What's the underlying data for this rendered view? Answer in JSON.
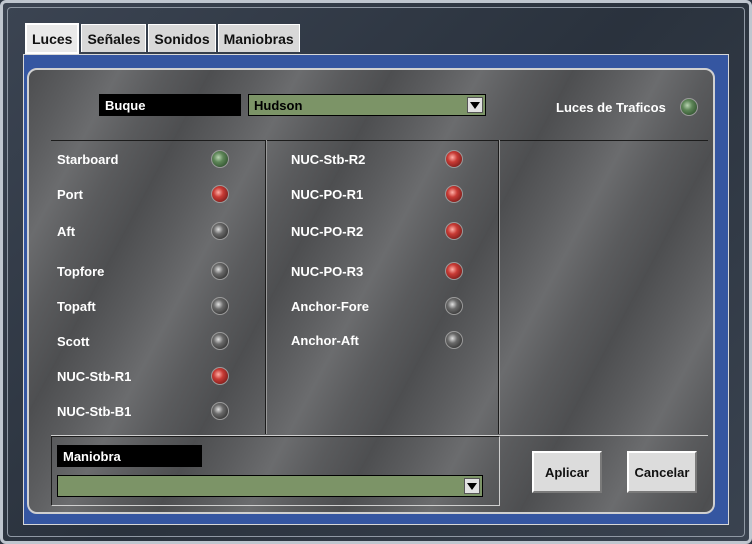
{
  "tabs": [
    {
      "label": "Luces",
      "active": true
    },
    {
      "label": "Señales",
      "active": false
    },
    {
      "label": "Sonidos",
      "active": false
    },
    {
      "label": "Maniobras",
      "active": false
    }
  ],
  "buque": {
    "label": "Buque",
    "selected": "Hudson"
  },
  "traffic_lights": {
    "label": "Luces de Traficos",
    "state": "green"
  },
  "lights_col1": [
    {
      "label": "Starboard",
      "state": "green"
    },
    {
      "label": "Port",
      "state": "red"
    },
    {
      "label": "Aft",
      "state": "off"
    },
    {
      "label": "Topfore",
      "state": "off"
    },
    {
      "label": "Topaft",
      "state": "off"
    },
    {
      "label": "Scott",
      "state": "off"
    },
    {
      "label": "NUC-Stb-R1",
      "state": "red"
    },
    {
      "label": "NUC-Stb-B1",
      "state": "off"
    }
  ],
  "lights_col2": [
    {
      "label": "NUC-Stb-R2",
      "state": "red"
    },
    {
      "label": "NUC-PO-R1",
      "state": "red"
    },
    {
      "label": "NUC-PO-R2",
      "state": "red"
    },
    {
      "label": "NUC-PO-R3",
      "state": "red"
    },
    {
      "label": "Anchor-Fore",
      "state": "off"
    },
    {
      "label": "Anchor-Aft",
      "state": "off"
    }
  ],
  "maniobra": {
    "label": "Maniobra",
    "selected": ""
  },
  "buttons": {
    "apply": "Aplicar",
    "cancel": "Cancelar"
  },
  "colors": {
    "combo_bg": "#7c9467",
    "panel_border": "#3556a1",
    "lamp_green": "#5e8658",
    "lamp_red": "#c83b35",
    "lamp_off": "#6a6a6a"
  }
}
